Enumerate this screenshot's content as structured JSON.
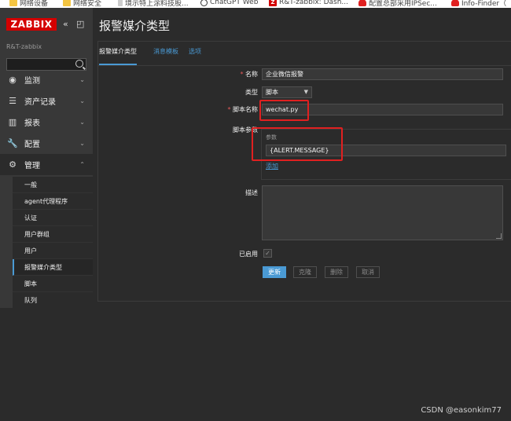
{
  "bookmarks": [
    {
      "label": "网络设备",
      "icon": "folder-icon"
    },
    {
      "label": "网络安全",
      "icon": "folder-icon"
    },
    {
      "label": "境示特上涂料技股...",
      "icon": "page-icon"
    },
    {
      "label": "ChatGPT Web",
      "icon": "chatgpt-icon"
    },
    {
      "label": "R&T-zabbix: Dash...",
      "icon": "zabbix-icon"
    },
    {
      "label": "配置总部采用IPSec...",
      "icon": "huawei-icon"
    },
    {
      "label": "Info-Finder（",
      "icon": "huawei-icon"
    }
  ],
  "sidebar": {
    "logo": "ZABBIX",
    "collapse_icon": "«",
    "kiosk_icon": "◰",
    "subtitle": "R&T-zabbix",
    "search_placeholder": "",
    "menu": [
      {
        "label": "监测",
        "icon": "eye-icon",
        "chevron": "⌄"
      },
      {
        "label": "资产记录",
        "icon": "list-icon",
        "chevron": "⌄"
      },
      {
        "label": "报表",
        "icon": "report-icon",
        "chevron": "⌄"
      },
      {
        "label": "配置",
        "icon": "wrench-icon",
        "chevron": "⌄"
      },
      {
        "label": "管理",
        "icon": "gear-icon",
        "chevron": "⌃"
      }
    ],
    "submenu": [
      "一般",
      "agent代理程序",
      "认证",
      "用户群组",
      "用户",
      "报警媒介类型",
      "脚本",
      "队列"
    ]
  },
  "main": {
    "title": "报警媒介类型",
    "tabs": [
      "报警媒介类型",
      "消息模板",
      "选项"
    ],
    "form": {
      "name_label": "名称",
      "name_value": "企业微信报警",
      "type_label": "类型",
      "type_value": "脚本",
      "script_name_label": "脚本名称",
      "script_name_value": "wechat.py",
      "script_params_label": "脚本参数",
      "params_header": "参数",
      "param_value": "{ALERT.MESSAGE}",
      "add_link": "添加",
      "description_label": "描述",
      "enabled_label": "已启用",
      "enabled_mark": "✓",
      "required_mark": "*"
    },
    "buttons": [
      "更新",
      "克隆",
      "删除",
      "取消"
    ]
  },
  "watermark": "CSDN @easonkim77",
  "colors": {
    "brand": "#d40000",
    "accent": "#4a9ad4",
    "annotation": "#e02020"
  }
}
